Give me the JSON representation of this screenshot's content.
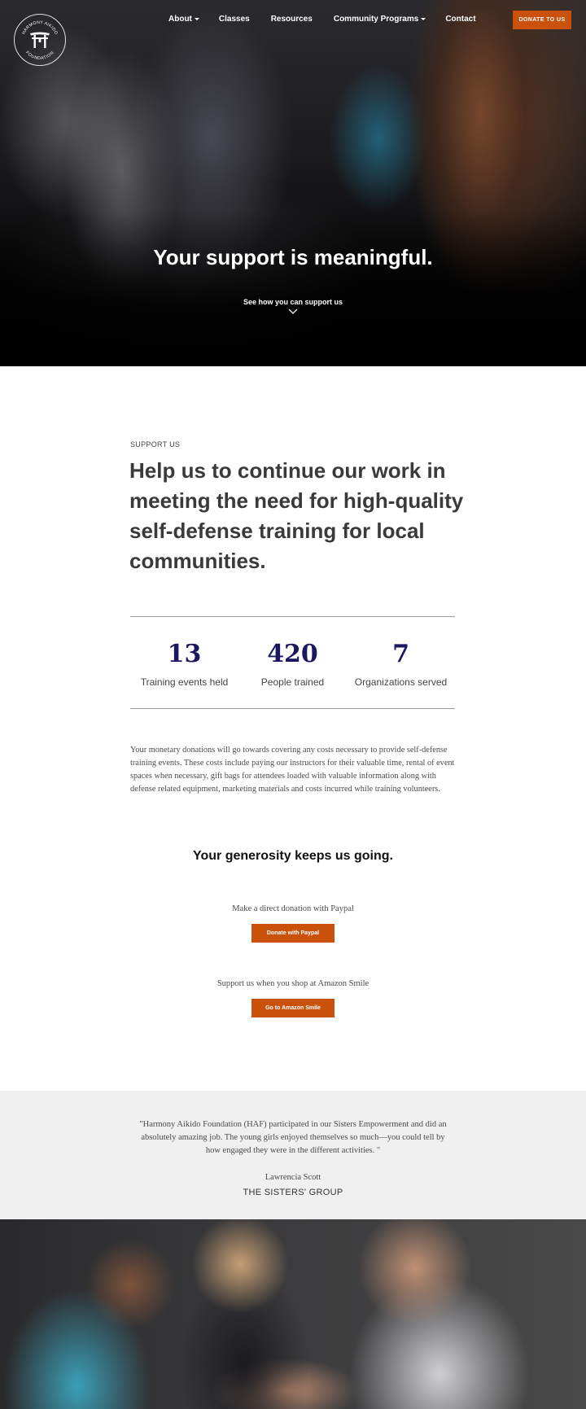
{
  "header": {
    "logo_text": "HARMONY AIKIDO FOUNDATION",
    "nav": [
      {
        "label": "About",
        "has_dropdown": true
      },
      {
        "label": "Classes",
        "has_dropdown": false
      },
      {
        "label": "Resources",
        "has_dropdown": false
      },
      {
        "label": "Community Programs",
        "has_dropdown": true
      },
      {
        "label": "Contact",
        "has_dropdown": false
      }
    ],
    "donate_label": "DONATE TO US"
  },
  "hero": {
    "title": "Your support is meaningful.",
    "subtitle": "See how you can support us"
  },
  "support": {
    "eyebrow": "SUPPORT US",
    "headline": "Help us to continue our work in meeting the need for high-quality self-defense training for local communities."
  },
  "stats": [
    {
      "value": "13",
      "label": "Training events held"
    },
    {
      "value": "420",
      "label": "People trained"
    },
    {
      "value": "7",
      "label": "Organizations served"
    }
  ],
  "body_text": "Your monetary donations will go towards covering any costs necessary to provide self-defense training events. These costs include paying our instructors for their valuable time, rental of event spaces when necessary, gift bags for attendees loaded with valuable information along with defense related equipment, marketing materials and costs incurred while training volunteers.",
  "generosity": {
    "title": "Your generosity keeps us going.",
    "paypal_text": "Make a direct donation with Paypal",
    "paypal_button": "Donate with Paypal",
    "amazon_text": "Support us when you shop at Amazon Smile",
    "amazon_button": "Go to Amazon Smile"
  },
  "testimonial": {
    "quote": "\"Harmony Aikido Foundation (HAF) participated in our Sisters Empowerment and did an absolutely amazing job. The young girls enjoyed themselves so much—you could tell by how engaged they were in the different activities. \"",
    "author": "Lawrencia Scott",
    "organization": "THE SISTERS' GROUP"
  },
  "colors": {
    "accent": "#c9510c",
    "stat_number": "#1b1760",
    "testimonial_bg": "#f0f0f0"
  },
  "icons": [
    "torii-gate-logo",
    "caret-down-icon",
    "chevron-down-icon"
  ]
}
